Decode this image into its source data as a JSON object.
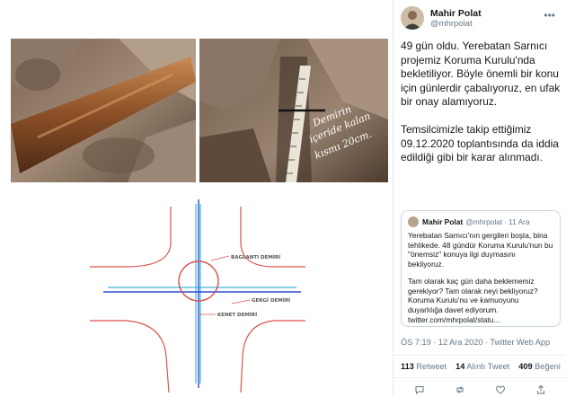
{
  "tweet": {
    "author_name": "Mahir Polat",
    "author_handle": "@mhrpolat",
    "paragraphs": [
      "49 gün oldu. Yerebatan Sarnıcı projemiz Koruma Kurulu'nda bekletiliyor. Böyle önemli bir konu için günlerdir çabalıyoruz, en ufak bir onay alamıyoruz.",
      "Temsilcimizle takip ettiğimiz 09.12.2020 toplantısında da iddia edildiği gibi bir karar alınmadı."
    ],
    "timestamp": "ÖS 7:19 · 12 Ara 2020 · Twitter Web App",
    "retweets_count": "113",
    "retweets_label": "Retweet",
    "quotes_count": "14",
    "quotes_label": "Alıntı Tweet",
    "likes_count": "409",
    "likes_label": "Beğeni"
  },
  "quoted": {
    "author_name": "Mahir Polat",
    "author_handle": "@mhrpolat",
    "separator": "·",
    "date": "11 Ara",
    "paragraphs": [
      "Yerebatan Sarnıcı'nın gergileri boşta, bina tehlikede. 48 gündür Koruma Kurulu'nun bu \"önemsiz\" konuya ilgi duymasını bekliyoruz.",
      "Tam olarak kaç gün daha beklememiz gerekiyor? Tam olarak neyi bekliyoruz? Koruma Kurulu'nu ve kamuoyunu duyarlılığa davet ediyorum. twitter.com/mhrpolat/statu..."
    ]
  },
  "media": {
    "photo_annotation_lines": [
      "Demirin",
      "içeride kalan",
      "kısmı 20cm."
    ],
    "diagram_labels": {
      "baglanti": "BAGLANTI DEMİRİ",
      "gergi": "GERGİ DEMİRİ",
      "kenet": "KENET DEMİRİ"
    }
  },
  "icons": {
    "more": "more-dots-icon",
    "reply": "reply-icon",
    "retweet": "retweet-icon",
    "like": "heart-icon",
    "share": "share-icon"
  },
  "colors": {
    "diagram_red": "#d9534f",
    "diagram_blue": "#2b4fd8",
    "diagram_cyan": "#3fb8d6",
    "text_secondary": "#657786"
  }
}
